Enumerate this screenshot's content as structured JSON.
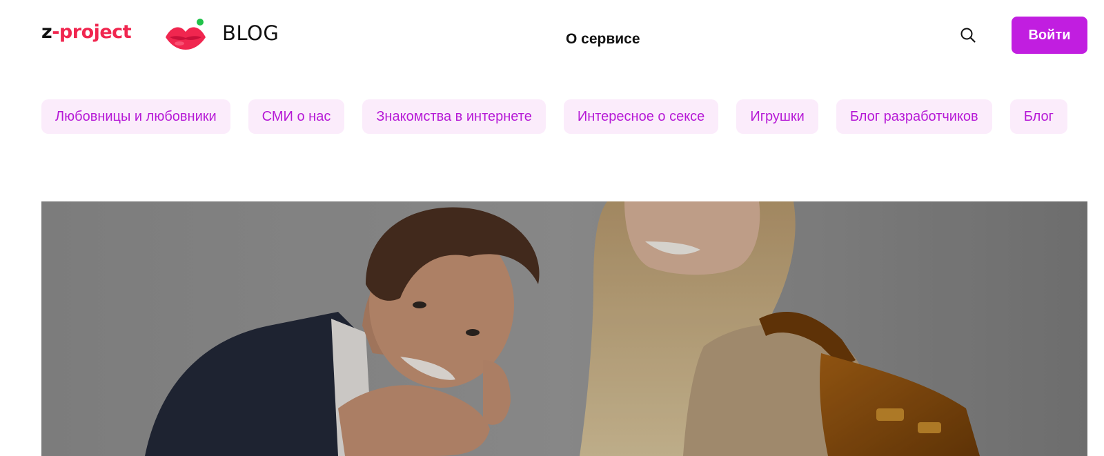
{
  "header": {
    "logo": {
      "prefix": "z",
      "rest": "-project",
      "prefix_color": "#111111",
      "rest_color": "#f0264f"
    },
    "blog_label": "BLOG",
    "nav_about": "О сервисе",
    "search_icon": "search-icon",
    "login_label": "Войти",
    "accent_color": "#c11ee0"
  },
  "categories": [
    "Любовницы и любовники",
    "СМИ о нас",
    "Знакомства в интернете",
    "Интересное о сексе",
    "Игрушки",
    "Блог разработчиков",
    "Блог"
  ],
  "chip_colors": {
    "background": "#fbecfb",
    "text": "#b61ad6"
  }
}
